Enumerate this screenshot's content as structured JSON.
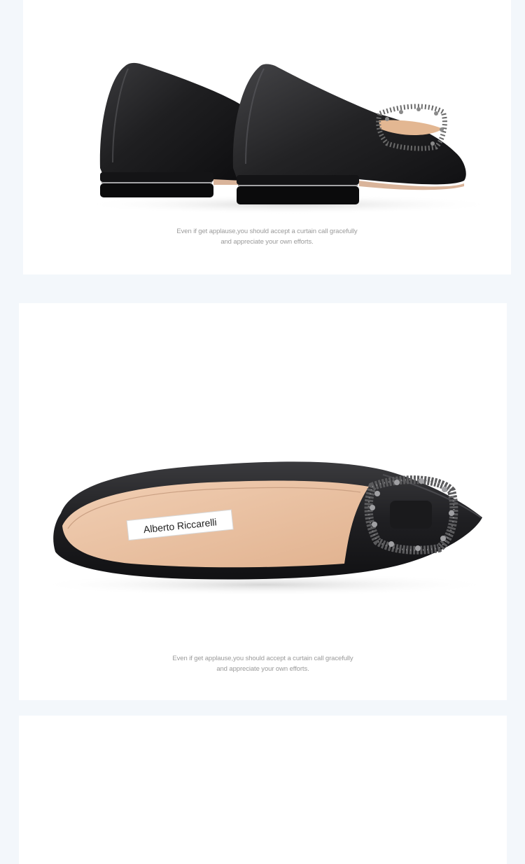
{
  "page": {
    "background": "#f3f7fb",
    "card_background": "#ffffff"
  },
  "sections": [
    {
      "image": "black-satin-flats-rear-view",
      "caption_line1": "Even if get applause,you should accept a curtain call gracefully",
      "caption_line2": "and appreciate your own efforts."
    },
    {
      "image": "black-satin-flat-side-view-with-crystal-buckle",
      "brand_label": "Alberto Riccarelli",
      "caption_line1": "Even if get applause,you should accept a curtain call gracefully",
      "caption_line2": "and appreciate your own efforts."
    },
    {
      "image": "blank-section"
    }
  ],
  "colors": {
    "satin_black": "#1d1d1f",
    "lining_nude": "#e9c4a6",
    "crystal_gray": "#6a6a6a",
    "caption_gray": "#9a9a9a"
  }
}
